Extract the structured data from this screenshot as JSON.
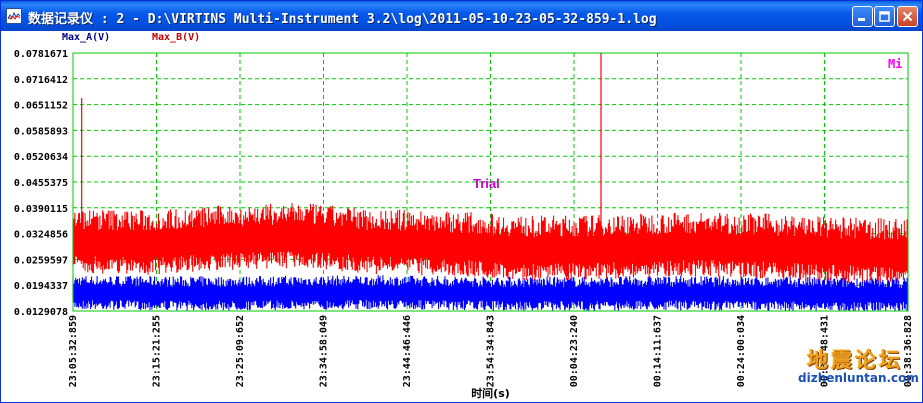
{
  "window": {
    "title": "数据记录仪 : 2 - D:\\VIRTINS Multi-Instrument 3.2\\log\\2011-05-10-23-05-32-859-1.log",
    "icon": "chart-log-icon",
    "controls": {
      "minimize": "minimize-icon",
      "maximize": "maximize-icon",
      "close": "close-icon"
    }
  },
  "chart": {
    "corner_mark": "Mi",
    "watermark_overlay": "Trial",
    "colors": {
      "plot_background": "#ffffff",
      "grid": "#00c800",
      "frame": "#00c800",
      "series_a": "#0000ff",
      "series_b": "#ff0000",
      "legend_a": "#00008b",
      "legend_b": "#c00000",
      "corner_mark": "#ff00ff",
      "overlay": "#cc00cc"
    }
  },
  "chart_data": {
    "type": "line",
    "xlabel": "时间(s)",
    "ylabel": "",
    "x_tick_labels": [
      "23:05:32:859",
      "23:15:21:255",
      "23:25:09:652",
      "23:34:58:049",
      "23:44:46:446",
      "23:54:34:843",
      "00:04:23:240",
      "00:14:11:637",
      "00:24:00:034",
      "00:33:48:431",
      "00:38:36:828"
    ],
    "y_tick_labels": [
      "0.0781671",
      "0.0716412",
      "0.0651152",
      "0.0585893",
      "0.0520634",
      "0.0455375",
      "0.0390115",
      "0.0324856",
      "0.0259597",
      "0.0194337",
      "0.0129078"
    ],
    "ylim": [
      0.0129078,
      0.0781671
    ],
    "grid": true,
    "legend_position": "top-left",
    "series": [
      {
        "name": "Max_A(V)",
        "values": [
          0.0178,
          0.0176,
          0.0175,
          0.0177,
          0.0178,
          0.0176,
          0.0174,
          0.0175,
          0.0176,
          0.0175,
          0.0173,
          0.0172
        ],
        "noise_band": [
          0.0138,
          0.0212
        ]
      },
      {
        "name": "Max_B(V)",
        "values": [
          0.0305,
          0.03,
          0.0312,
          0.0318,
          0.0302,
          0.0298,
          0.0285,
          0.0288,
          0.0295,
          0.0292,
          0.0282,
          0.0278
        ],
        "noise_band": [
          0.0196,
          0.0405
        ]
      }
    ],
    "spikes": [
      {
        "series": "Max_B(V)",
        "x": "23:06:30",
        "value": 0.0668
      },
      {
        "series": "Max_B(V)",
        "x": "00:04:23:240",
        "value": 0.0781671
      }
    ]
  },
  "watermark": {
    "line1": "地震论坛",
    "line2": "dizhenluntan.com",
    "colors": [
      "#ffd700",
      "#ff8c00",
      "#8b4513"
    ]
  }
}
